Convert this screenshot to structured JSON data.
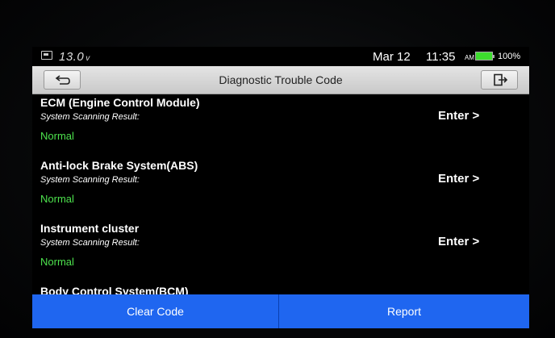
{
  "status_bar": {
    "voltage": "13.0",
    "voltage_unit": "v",
    "date": "Mar 12",
    "time": "11:35",
    "ampm": "AM",
    "battery": "100%",
    "battery_level": 1.0,
    "battery_color": "#3ddc2e"
  },
  "header": {
    "title": "Diagnostic Trouble Code",
    "back_icon": "return-arrow-icon",
    "exit_icon": "exit-icon"
  },
  "systems": [
    {
      "name": "ECM (Engine Control Module)",
      "scan_label": "System Scanning Result:",
      "result": "Normal",
      "enter": "Enter >"
    },
    {
      "name": "Anti-lock Brake System(ABS)",
      "scan_label": "System Scanning Result:",
      "result": "Normal",
      "enter": "Enter >"
    },
    {
      "name": "Instrument cluster",
      "scan_label": "System Scanning Result:",
      "result": "Normal",
      "enter": "Enter >"
    },
    {
      "name": "Body Control System(BCM)"
    }
  ],
  "footer": {
    "clear_label": "Clear Code",
    "report_label": "Report"
  },
  "colors": {
    "accent": "#1f66f0",
    "normal_status": "#4de24d"
  }
}
